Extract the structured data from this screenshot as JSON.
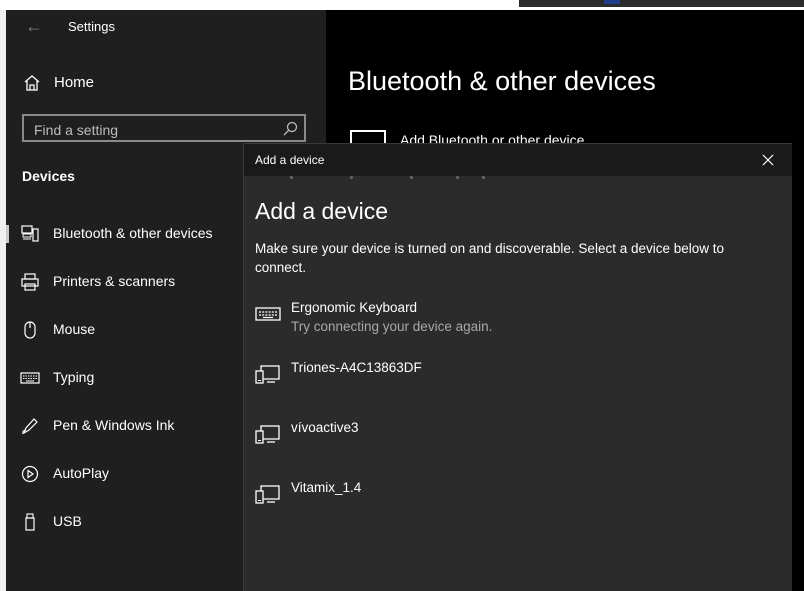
{
  "window": {
    "title": "Settings"
  },
  "sidebar": {
    "home_label": "Home",
    "search_placeholder": "Find a setting",
    "section_title": "Devices",
    "items": [
      {
        "label": "Bluetooth & other devices",
        "icon": "bluetooth-devices-icon",
        "selected": true
      },
      {
        "label": "Printers & scanners",
        "icon": "printer-icon",
        "selected": false
      },
      {
        "label": "Mouse",
        "icon": "mouse-icon",
        "selected": false
      },
      {
        "label": "Typing",
        "icon": "keyboard-icon",
        "selected": false
      },
      {
        "label": "Pen & Windows Ink",
        "icon": "pen-icon",
        "selected": false
      },
      {
        "label": "AutoPlay",
        "icon": "autoplay-icon",
        "selected": false
      },
      {
        "label": "USB",
        "icon": "usb-icon",
        "selected": false
      }
    ]
  },
  "main": {
    "title": "Bluetooth & other devices",
    "add_label": "Add Bluetooth or other device"
  },
  "dialog": {
    "title": "Add a device",
    "heading": "Add a device",
    "description": "Make sure your device is turned on and discoverable. Select a device below to connect.",
    "devices": [
      {
        "name": "Ergonomic Keyboard",
        "status": "Try connecting your device again.",
        "icon": "keyboard-icon"
      },
      {
        "name": "Triones-A4C13863DF",
        "status": "",
        "icon": "generic-device-icon"
      },
      {
        "name": "vívoactive3",
        "status": "",
        "icon": "generic-device-icon"
      },
      {
        "name": "Vitamix_1.4",
        "status": "",
        "icon": "generic-device-icon"
      }
    ]
  },
  "colors": {
    "sidebar_bg": "#1f1f1f",
    "main_bg": "#000000",
    "dialog_bg": "#2b2b2b",
    "text": "#ffffff",
    "secondary_text": "#a8a8a8"
  }
}
